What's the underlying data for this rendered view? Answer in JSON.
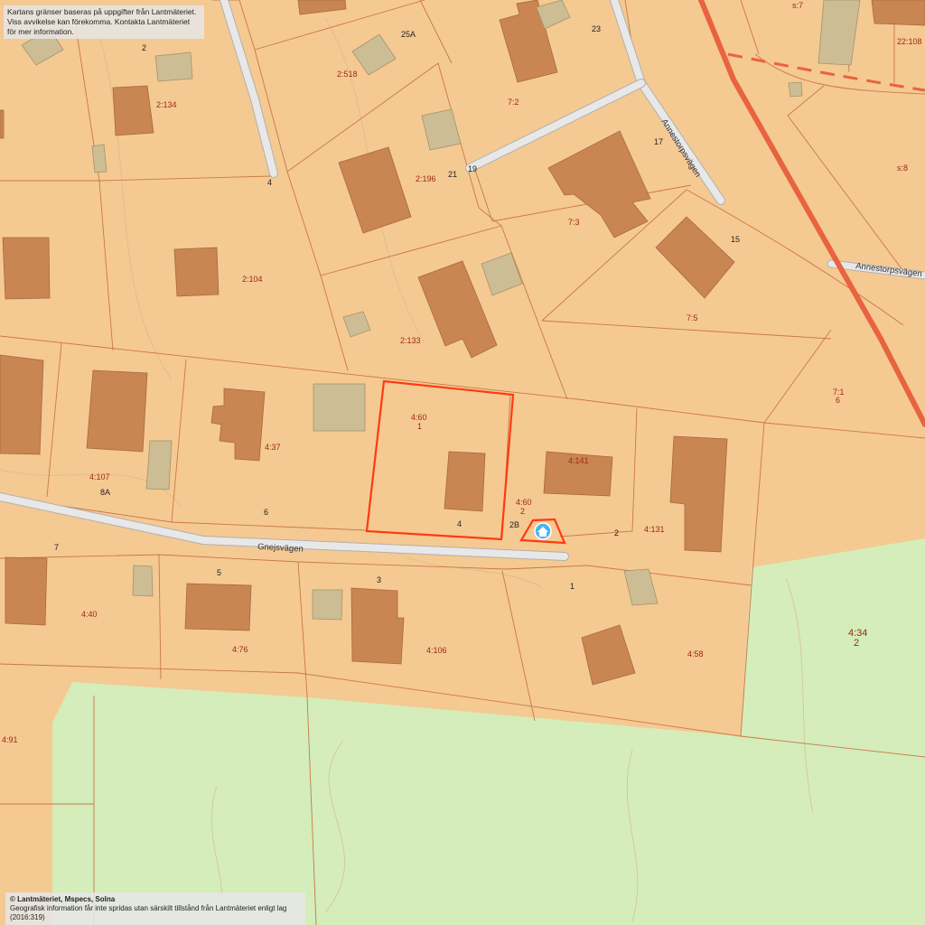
{
  "map": {
    "notice_line1": "Kartans gränser baseras på uppgifter från Lantmäteriet.",
    "notice_line2": "Viss avvikelse kan förekomma. Kontakta Lantmäteriet för mer information.",
    "copyright_line1": "© Lantmäteriet, Mspecs, Solna",
    "copyright_line2": "Geografisk information får inte spridas utan särskilt tillstånd från Lantmäteriet enligt lag (2016:319)",
    "colors": {
      "land": "#f5c992",
      "green_area": "#d4edba",
      "parcel_line": "#c97848",
      "building": "#c98552",
      "outbuilding": "#cdbd94",
      "road": "#e8e8e8",
      "road_edge": "#b0b0b0",
      "main_road": "#e8633f",
      "highlight": "#ff3a10"
    },
    "icons": {
      "property_marker": "home-marker-icon"
    }
  },
  "roads": [
    {
      "name": "Gnejsvägen"
    },
    {
      "name": "Annestorpsvägen"
    },
    {
      "name": "Annestorpsvägen"
    }
  ],
  "parcels": [
    {
      "id": "2:134"
    },
    {
      "id": "2:518"
    },
    {
      "id": "7:2"
    },
    {
      "id": "s:7"
    },
    {
      "id": "22:108"
    },
    {
      "id": "2:196"
    },
    {
      "id": "7:3"
    },
    {
      "id": "s:8"
    },
    {
      "id": "2:104"
    },
    {
      "id": "7:5"
    },
    {
      "id": "2:133"
    },
    {
      "id": "7:1"
    },
    {
      "id": "4:60"
    },
    {
      "id": "4:37"
    },
    {
      "id": "4:141"
    },
    {
      "id": "4:107"
    },
    {
      "id": "4:60"
    },
    {
      "id": "4:131"
    },
    {
      "id": "4:40"
    },
    {
      "id": "4:76"
    },
    {
      "id": "4:106"
    },
    {
      "id": "4:58"
    },
    {
      "id": "4:34"
    },
    {
      "id": "4:91"
    }
  ],
  "addresses": [
    "2",
    "25A",
    "23",
    "17",
    "21",
    "19",
    "4",
    "15",
    "6",
    "1",
    "8A",
    "6",
    "2",
    "4",
    "2B",
    "2",
    "7",
    "5",
    "3",
    "1",
    "2"
  ]
}
